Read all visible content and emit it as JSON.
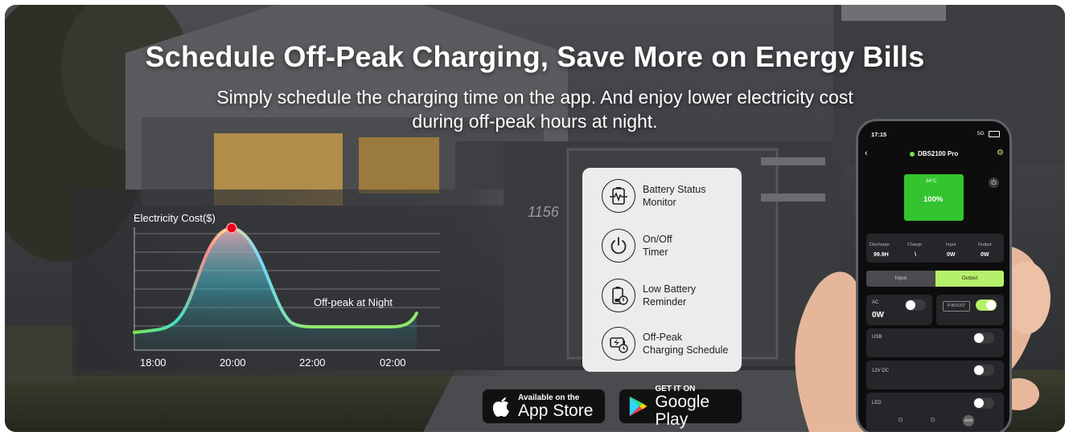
{
  "banner": {
    "title": "Schedule Off-Peak Charging, Save More on Energy Bills",
    "subtitle_line1": "Simply schedule the charging time on the app. And enjoy lower electricity cost",
    "subtitle_line2": "during off-peak hours at night.",
    "house_number": "1156"
  },
  "chart_data": {
    "type": "line",
    "title": "Electricity Cost($)",
    "annotation": "Off-peak at Night",
    "x_tick_labels": [
      "18:00",
      "20:00",
      "22:00",
      "02:00"
    ],
    "peak_at": "20:00",
    "grid": true
  },
  "features": [
    {
      "icon": "battery-pulse-icon",
      "line1": "Battery Status",
      "line2": "Monitor"
    },
    {
      "icon": "power-icon",
      "line1": "On/Off",
      "line2": "Timer"
    },
    {
      "icon": "low-battery-icon",
      "line1": "Low Battery",
      "line2": "Reminder"
    },
    {
      "icon": "charge-schedule-icon",
      "line1": "Off-Peak",
      "line2": "Charging Schedule"
    }
  ],
  "store_badges": {
    "appstore_small": "Available on the",
    "appstore_big": "App Store",
    "googleplay_small": "GET IT ON",
    "googleplay_big": "Google Play"
  },
  "phone": {
    "time": "17:15",
    "signal": "5G",
    "device_name": "DBS2100 Pro",
    "temp": "34°C",
    "battery_percent": "100%",
    "stats": [
      {
        "label": "Discharge",
        "value": "99.9H"
      },
      {
        "label": "Charge",
        "value": "\\"
      },
      {
        "label": "Input",
        "value": "0W"
      },
      {
        "label": "Output",
        "value": "0W"
      }
    ],
    "tab_input": "Input",
    "tab_output": "Output",
    "ac_label": "AC",
    "ac_value": "0W",
    "boost_label": "P-BOOST",
    "usb_label": "USB",
    "dc_label": "12V DC",
    "led_label": "LED",
    "led_sos": "SOS",
    "colors": {
      "accent_green": "#33c42f",
      "tab_green": "#b5f06a"
    }
  }
}
